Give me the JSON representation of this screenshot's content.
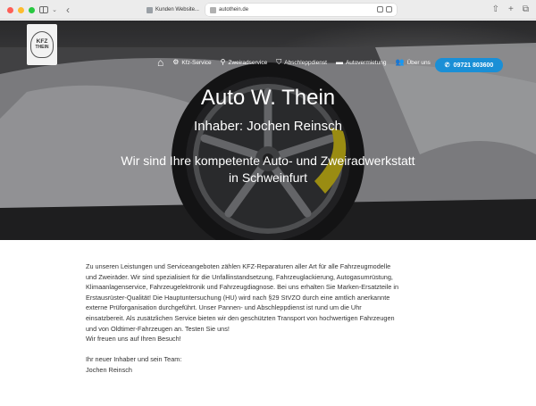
{
  "browser": {
    "tab_title": "Kunden Website...",
    "address": "autothein.de"
  },
  "nav": {
    "items": [
      {
        "icon": "gear-icon",
        "label": "Kfz-Service"
      },
      {
        "icon": "motorbike-icon",
        "label": "Zweiradservice"
      },
      {
        "icon": "shield-icon",
        "label": "Abschleppdienst"
      },
      {
        "icon": "car-icon",
        "label": "Autovermietung"
      },
      {
        "icon": "users-icon",
        "label": "Über uns"
      }
    ],
    "phone": "09721 803600"
  },
  "logo": {
    "line1": "KFZ",
    "line2": "THEIN"
  },
  "hero": {
    "title": "Auto W. Thein",
    "subtitle": "Inhaber: Jochen Reinsch",
    "tagline_1": "Wir sind Ihre kompetente Auto- und Zweiradwerkstatt",
    "tagline_2": "in Schweinfurt"
  },
  "content": {
    "lines": [
      "Zu unseren Leistungen und Serviceangeboten zählen KFZ-Reparaturen aller Art für alle Fahrzeugmodelle",
      "und Zweiräder. Wir sind spezialisiert für die Unfallinstandsetzung, Fahrzeuglackierung, Autogasumrüstung,",
      "Klimaanlagenservice, Fahrzeugelektronik und Fahrzeugdiagnose. Bei uns erhalten Sie Marken-Ersatzteile in",
      "Erstausrüster-Qualität! Die Hauptuntersuchung (HU) wird nach §29 StVZO durch eine amtlich anerkannte",
      "externe Prüforganisation durchgeführt. Unser Pannen- und Abschleppdienst ist rund um die Uhr",
      "einsatzbereit. Als zusätzlichen Service bieten wir den geschützten Transport von hochwertigen Fahrzeugen",
      "und von Oldtimer-Fahrzeugen an. Testen Sie uns!",
      "Wir freuen uns auf Ihren Besuch!"
    ],
    "closing_1": "Ihr neuer Inhaber und sein Team:",
    "closing_2": "Jochen Reinsch"
  }
}
